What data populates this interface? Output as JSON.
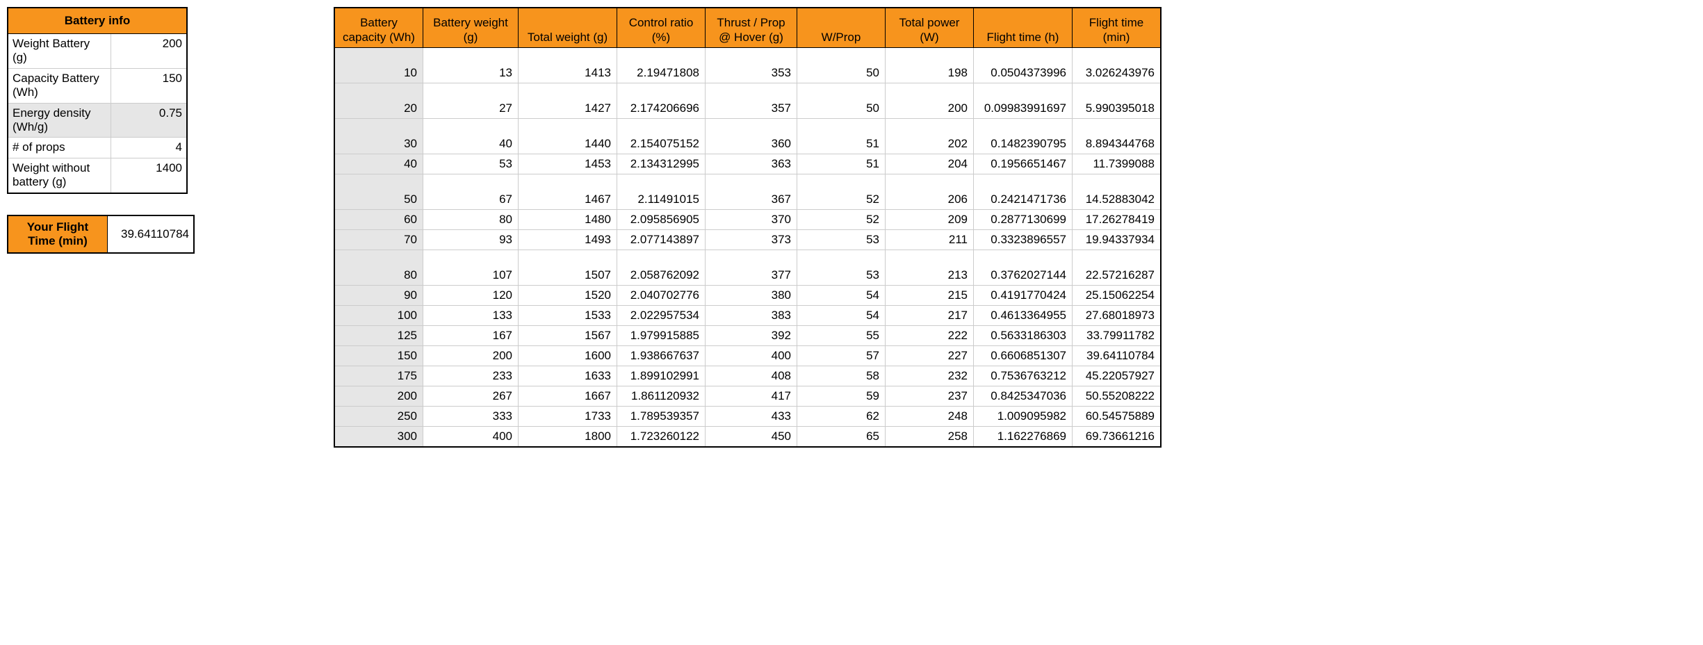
{
  "info": {
    "title": "Battery info",
    "rows": [
      {
        "label": "Weight Battery (g)",
        "value": "200",
        "shaded": false,
        "tall": true
      },
      {
        "label": "Capacity Battery (Wh)",
        "value": "150",
        "shaded": false,
        "tall": true
      },
      {
        "label": "Energy density (Wh/g)",
        "value": "0.75",
        "shaded": true,
        "tall": true
      },
      {
        "label": "# of props",
        "value": "4",
        "shaded": false,
        "tall": false
      },
      {
        "label": "Weight without battery (g)",
        "value": "1400",
        "shaded": false,
        "tall": true
      }
    ]
  },
  "flight": {
    "label": "Your Flight Time (min)",
    "value": "39.64110784"
  },
  "table": {
    "headers": [
      "Battery capacity (Wh)",
      "Battery weight (g)",
      "Total weight (g)",
      "Control ratio (%)",
      "Thrust / Prop @ Hover (g)",
      "W/Prop",
      "Total power (W)",
      "Flight time (h)",
      "Flight time (min)"
    ],
    "rows": [
      {
        "tall": true,
        "cells": [
          "10",
          "13",
          "1413",
          "2.19471808",
          "353",
          "50",
          "198",
          "0.0504373996",
          "3.026243976"
        ]
      },
      {
        "tall": true,
        "cells": [
          "20",
          "27",
          "1427",
          "2.174206696",
          "357",
          "50",
          "200",
          "0.09983991697",
          "5.990395018"
        ]
      },
      {
        "tall": true,
        "cells": [
          "30",
          "40",
          "1440",
          "2.154075152",
          "360",
          "51",
          "202",
          "0.1482390795",
          "8.894344768"
        ]
      },
      {
        "tall": false,
        "cells": [
          "40",
          "53",
          "1453",
          "2.134312995",
          "363",
          "51",
          "204",
          "0.1956651467",
          "11.7399088"
        ]
      },
      {
        "tall": true,
        "cells": [
          "50",
          "67",
          "1467",
          "2.11491015",
          "367",
          "52",
          "206",
          "0.2421471736",
          "14.52883042"
        ]
      },
      {
        "tall": false,
        "cells": [
          "60",
          "80",
          "1480",
          "2.095856905",
          "370",
          "52",
          "209",
          "0.2877130699",
          "17.26278419"
        ]
      },
      {
        "tall": false,
        "cells": [
          "70",
          "93",
          "1493",
          "2.077143897",
          "373",
          "53",
          "211",
          "0.3323896557",
          "19.94337934"
        ]
      },
      {
        "tall": true,
        "cells": [
          "80",
          "107",
          "1507",
          "2.058762092",
          "377",
          "53",
          "213",
          "0.3762027144",
          "22.57216287"
        ]
      },
      {
        "tall": false,
        "cells": [
          "90",
          "120",
          "1520",
          "2.040702776",
          "380",
          "54",
          "215",
          "0.4191770424",
          "25.15062254"
        ]
      },
      {
        "tall": false,
        "cells": [
          "100",
          "133",
          "1533",
          "2.022957534",
          "383",
          "54",
          "217",
          "0.4613364955",
          "27.68018973"
        ]
      },
      {
        "tall": false,
        "cells": [
          "125",
          "167",
          "1567",
          "1.979915885",
          "392",
          "55",
          "222",
          "0.5633186303",
          "33.79911782"
        ]
      },
      {
        "tall": false,
        "cells": [
          "150",
          "200",
          "1600",
          "1.938667637",
          "400",
          "57",
          "227",
          "0.6606851307",
          "39.64110784"
        ]
      },
      {
        "tall": false,
        "cells": [
          "175",
          "233",
          "1633",
          "1.899102991",
          "408",
          "58",
          "232",
          "0.7536763212",
          "45.22057927"
        ]
      },
      {
        "tall": false,
        "cells": [
          "200",
          "267",
          "1667",
          "1.861120932",
          "417",
          "59",
          "237",
          "0.8425347036",
          "50.55208222"
        ]
      },
      {
        "tall": false,
        "cells": [
          "250",
          "333",
          "1733",
          "1.789539357",
          "433",
          "62",
          "248",
          "1.009095982",
          "60.54575889"
        ]
      },
      {
        "tall": false,
        "cells": [
          "300",
          "400",
          "1800",
          "1.723260122",
          "450",
          "65",
          "258",
          "1.162276869",
          "69.73661216"
        ]
      }
    ]
  }
}
